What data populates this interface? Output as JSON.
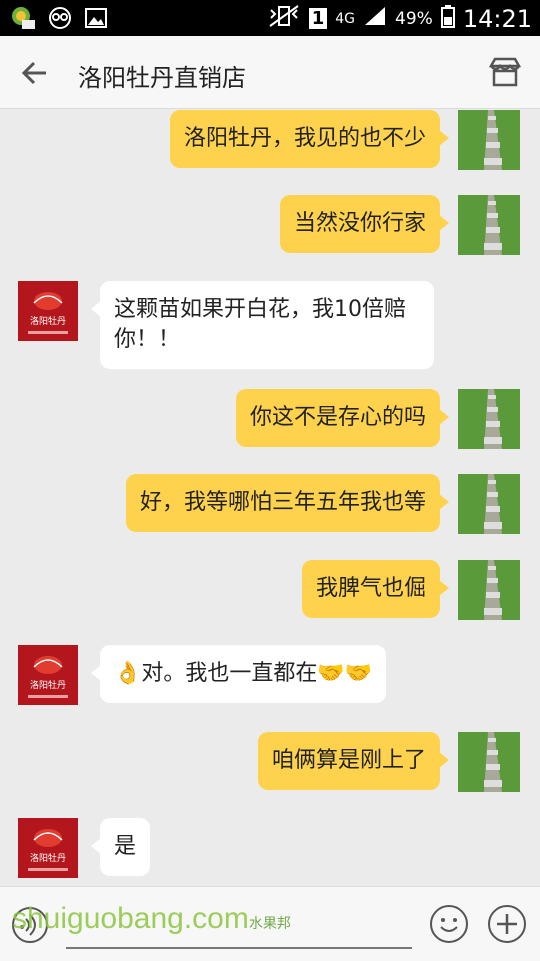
{
  "statusbar": {
    "battery": "49%",
    "network": "4G",
    "sim": "1",
    "time": "14:21"
  },
  "header": {
    "title": "洛阳牡丹直销店"
  },
  "messages": [
    {
      "from": "me",
      "text": "洛阳牡丹，我见的也不少"
    },
    {
      "from": "me",
      "text": "当然没你行家"
    },
    {
      "from": "them",
      "text": "这颗苗如果开白花，我10倍赔你！！"
    },
    {
      "from": "me",
      "text": "你这不是存心的吗"
    },
    {
      "from": "me",
      "text": "好，我等哪怕三年五年我也等"
    },
    {
      "from": "me",
      "text": "我脾气也倔"
    },
    {
      "from": "them",
      "text": "对。我也一直都在"
    },
    {
      "from": "me",
      "text": "咱俩算是刚上了"
    },
    {
      "from": "them",
      "text": "是"
    }
  ],
  "shop_avatar_text": "洛阳牡丹 直销店",
  "watermark": {
    "text": "shuiguobang.com",
    "cn": "水果邦"
  },
  "icons": {
    "back": "back-arrow-icon",
    "store": "store-icon",
    "voice": "voice-icon",
    "emoji": "smiley-icon",
    "plus": "plus-icon"
  }
}
